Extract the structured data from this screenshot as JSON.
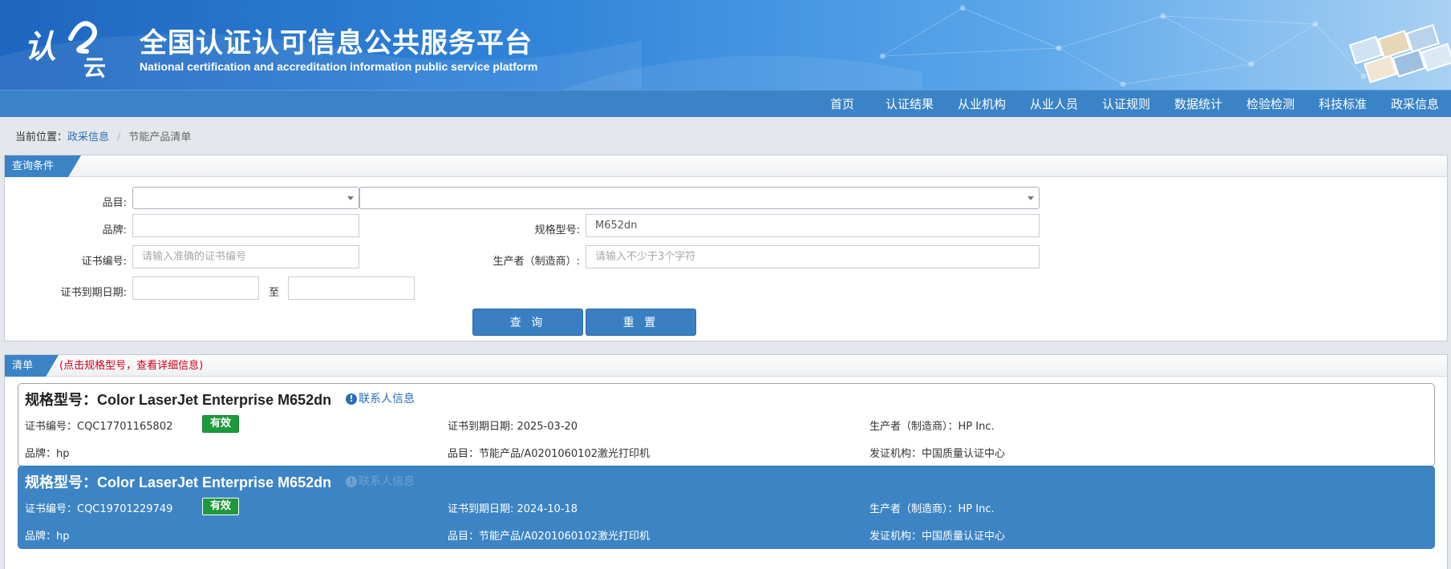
{
  "header": {
    "site_title": "全国认证认可信息公共服务平台",
    "site_subtitle": "National certification and accreditation information public service platform",
    "logo_text": "认e云"
  },
  "nav": {
    "items": [
      "首页",
      "认证结果",
      "从业机构",
      "从业人员",
      "认证规则",
      "数据统计",
      "检验检测",
      "科技标准",
      "政采信息"
    ]
  },
  "breadcrumb": {
    "prefix": "当前位置：",
    "parent": "政采信息",
    "separator": "/",
    "current": "节能产品清单"
  },
  "query": {
    "panel_title": "查询条件",
    "category_label": "品目:",
    "category_value_1": "",
    "category_value_2": "",
    "brand_label": "品牌:",
    "brand_value": "",
    "model_label": "规格型号:",
    "model_value": "M652dn",
    "cert_no_label": "证书编号:",
    "cert_no_placeholder": "请输入准确的证书编号",
    "producer_label": "生产者（制造商）:",
    "producer_placeholder": "请输入不少于3个字符",
    "expiry_label": "证书到期日期:",
    "expiry_from": "",
    "expiry_to_label": "至",
    "expiry_to": "",
    "search_button": "查 询",
    "reset_button": "重 置"
  },
  "results": {
    "panel_title": "清单",
    "hint": "(点击规格型号，查看详细信息)",
    "model_prefix": "规格型号：",
    "contact_label": "联系人信息",
    "items": [
      {
        "model": "Color LaserJet Enterprise M652dn",
        "cert_no": "证书编号：CQC17701165802",
        "status": "有效",
        "expiry": "证书到期日期: 2025-03-20",
        "producer": "生产者（制造商）：HP Inc.",
        "brand": "品牌：hp",
        "category": "品目：节能产品/A0201060102激光打印机",
        "issuer": "发证机构：中国质量认证中心"
      },
      {
        "model": "Color LaserJet Enterprise M652dn",
        "cert_no": "证书编号：CQC19701229749",
        "status": "有效",
        "expiry": "证书到期日期: 2024-10-18",
        "producer": "生产者（制造商）：HP Inc.",
        "brand": "品牌：hp",
        "category": "品目：节能产品/A0201060102激光打印机",
        "issuer": "发证机构：中国质量认证中心"
      }
    ]
  },
  "colors": {
    "brand_blue": "#3a83c6",
    "valid_green": "#1d9a3a",
    "hint_red": "#d0021b",
    "selected_row": "#3d84c4"
  }
}
